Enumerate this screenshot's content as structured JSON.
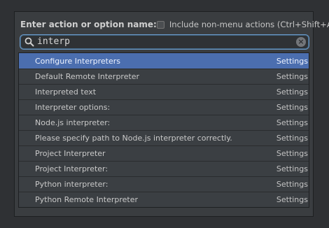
{
  "dialog": {
    "title": "Enter action or option name:",
    "include_label": "Include non-menu actions (Ctrl+Shift+A)"
  },
  "search": {
    "value": "interp",
    "placeholder": ""
  },
  "results": [
    {
      "name": "Configure Interpreters",
      "group": "Settings",
      "selected": true
    },
    {
      "name": "Default Remote Interpreter",
      "group": "Settings",
      "selected": false
    },
    {
      "name": "Interpreted text",
      "group": "Settings",
      "selected": false
    },
    {
      "name": "Interpreter options:",
      "group": "Settings",
      "selected": false
    },
    {
      "name": "Node.js interpreter:",
      "group": "Settings",
      "selected": false
    },
    {
      "name": "Please specify path to Node.js interpreter correctly.",
      "group": "Settings",
      "selected": false
    },
    {
      "name": "Project Interpreter",
      "group": "Settings",
      "selected": false
    },
    {
      "name": "Project Interpreter:",
      "group": "Settings",
      "selected": false
    },
    {
      "name": "Python interpreter:",
      "group": "Settings",
      "selected": false
    },
    {
      "name": "Python Remote Interpreter",
      "group": "Settings",
      "selected": false
    }
  ],
  "icons": {
    "search": "search-icon",
    "clear": "clear-search-icon",
    "checkbox": "checkbox-unchecked"
  },
  "colors": {
    "background": "#2f3134",
    "dialog": "#3a3d40",
    "selection": "#4b6eaf",
    "focus_border": "#6b99c7",
    "text": "#c9c9c9"
  }
}
